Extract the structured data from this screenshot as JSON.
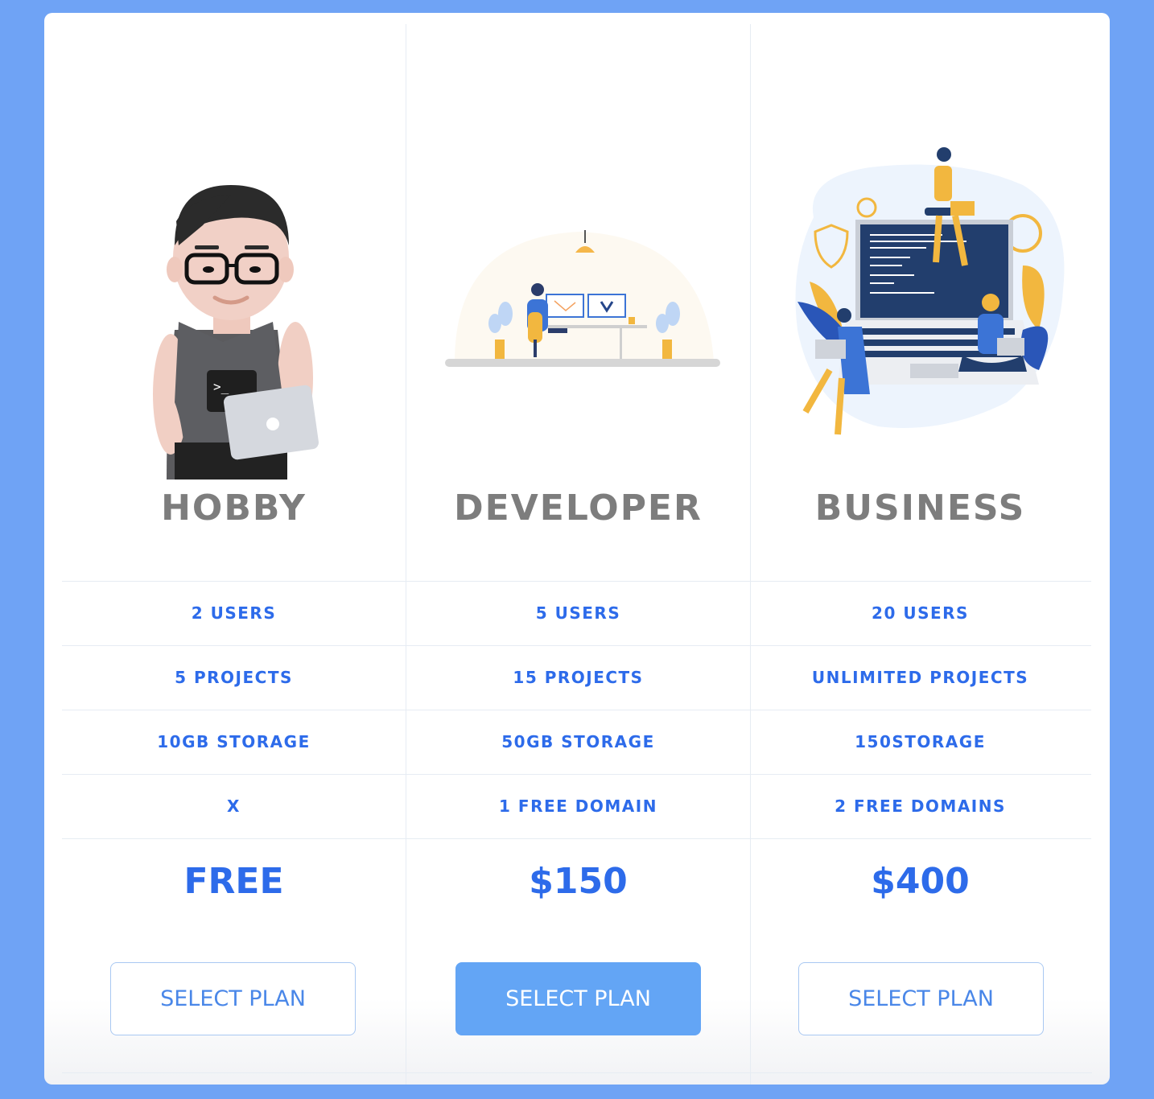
{
  "plans": [
    {
      "name": "HOBBY",
      "features": [
        "2 USERS",
        "5 PROJECTS",
        "10GB STORAGE",
        "X"
      ],
      "price": "FREE",
      "button_label": "SELECT PLAN",
      "selected": false,
      "illustration": "developer-avatar-with-laptop"
    },
    {
      "name": "DEVELOPER",
      "features": [
        "5 USERS",
        "15 PROJECTS",
        "50GB STORAGE",
        "1 FREE DOMAIN"
      ],
      "price": "$150",
      "button_label": "SELECT PLAN",
      "selected": true,
      "illustration": "person-at-desk-with-monitors"
    },
    {
      "name": "BUSINESS",
      "features": [
        "20 USERS",
        "UNLIMITED PROJECTS",
        "150STORAGE",
        "2 FREE DOMAINS"
      ],
      "price": "$400",
      "button_label": "SELECT PLAN",
      "selected": false,
      "illustration": "team-on-giant-laptop"
    }
  ],
  "colors": {
    "background": "#6fa3f5",
    "accent": "#2d6bea",
    "button_active": "#63a5f5",
    "plan_name": "#7d7d7d"
  }
}
